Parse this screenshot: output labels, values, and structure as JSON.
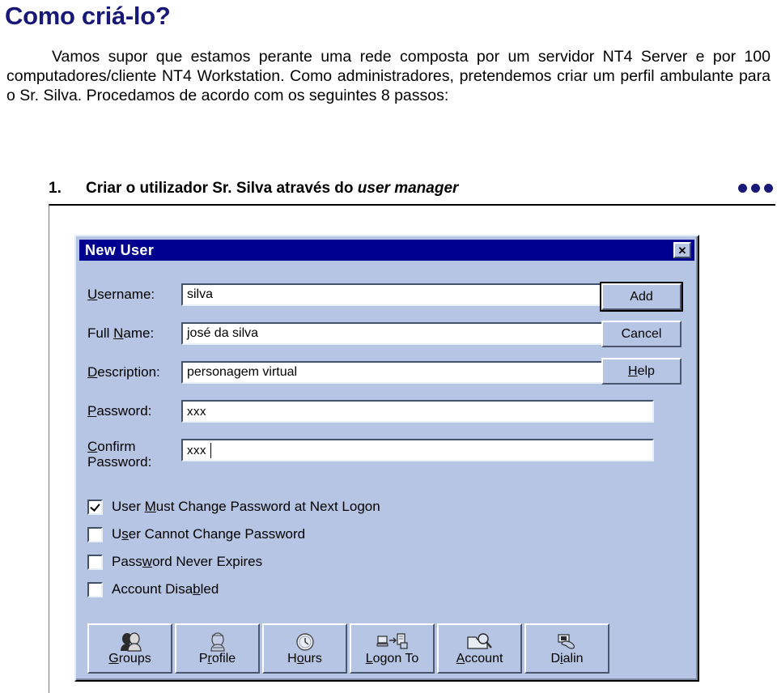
{
  "slide": {
    "title": "Como criá-lo?",
    "paragraph": "Vamos supor que estamos perante uma rede composta por um servidor NT4 Server e por 100 computadores/cliente NT4 Workstation. Como administradores, pretendemos criar um perfil ambulante para o Sr. Silva. Procedamos de acordo com os seguintes 8 passos:",
    "step": {
      "number": "1.",
      "text_before": "Criar o utilizador Sr. Silva através do ",
      "text_italic": "user manager"
    },
    "accent_color": "#181878"
  },
  "dialog": {
    "title": "New User",
    "close_label": "✕",
    "titlebar_color": "#000090",
    "face_color": "#b6c5e3",
    "fields": [
      {
        "label_pre": "",
        "label_key": "U",
        "label_post": "sername:",
        "value": "silva",
        "caret": false
      },
      {
        "label_pre": "Full ",
        "label_key": "N",
        "label_post": "ame:",
        "value": "josé da silva",
        "caret": false
      },
      {
        "label_pre": "",
        "label_key": "D",
        "label_post": "escription:",
        "value": "personagem virtual",
        "caret": false
      },
      {
        "label_pre": "",
        "label_key": "P",
        "label_post": "assword:",
        "value": "xxx",
        "caret": false
      },
      {
        "label_pre": "",
        "label_key": "C",
        "label_post": "onfirm Password:",
        "value": "xxx",
        "caret": true
      }
    ],
    "side_buttons": [
      {
        "label": "Add",
        "default": true
      },
      {
        "label": "Cancel",
        "default": false
      },
      {
        "label_pre": "",
        "label_key": "H",
        "label_post": "elp",
        "label": "Help",
        "default": false
      }
    ],
    "checkboxes": [
      {
        "pre": "User ",
        "key": "M",
        "post": "ust Change Password at Next Logon",
        "checked": true
      },
      {
        "pre": "U",
        "key": "s",
        "post": "er Cannot Change Password",
        "checked": false
      },
      {
        "pre": "Pass",
        "key": "w",
        "post": "ord Never Expires",
        "checked": false
      },
      {
        "pre": "Account Disa",
        "key": "b",
        "post": "led",
        "checked": false
      }
    ],
    "icon_buttons": [
      {
        "pre": "",
        "key": "G",
        "post": "roups",
        "icon": "two-people-icon"
      },
      {
        "pre": "P",
        "key": "r",
        "post": "ofile",
        "icon": "person-head-icon"
      },
      {
        "pre": "H",
        "key": "o",
        "post": "urs",
        "icon": "clock-icon"
      },
      {
        "pre": "",
        "key": "L",
        "post": "ogon To",
        "icon": "computer-to-server-icon"
      },
      {
        "pre": "",
        "key": "A",
        "post": "ccount",
        "icon": "folder-magnifier-icon"
      },
      {
        "pre": "D",
        "key": "i",
        "post": "alin",
        "icon": "modem-phone-icon"
      }
    ]
  }
}
